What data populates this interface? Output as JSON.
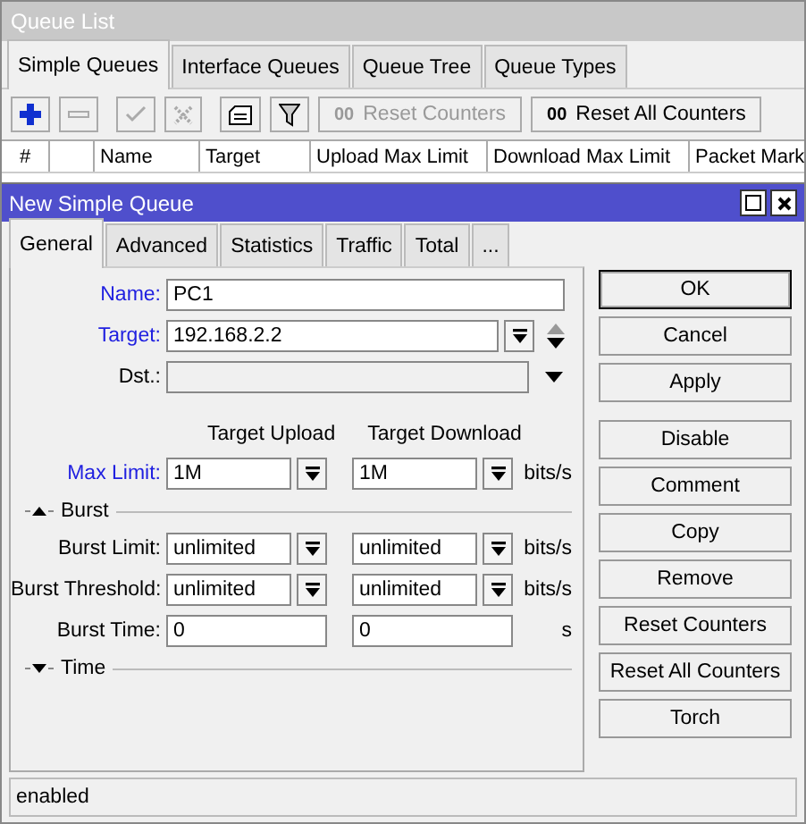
{
  "queue_list": {
    "title": "Queue List",
    "tabs": [
      {
        "label": "Simple Queues",
        "selected": true
      },
      {
        "label": "Interface Queues",
        "selected": false
      },
      {
        "label": "Queue Tree",
        "selected": false
      },
      {
        "label": "Queue Types",
        "selected": false
      }
    ],
    "toolbar": [
      {
        "kind": "add",
        "disabled": false
      },
      {
        "kind": "remove",
        "disabled": true
      },
      {
        "kind": "enable",
        "disabled": true
      },
      {
        "kind": "disable",
        "disabled": true
      },
      {
        "kind": "comment",
        "disabled": false
      },
      {
        "kind": "filter",
        "disabled": false
      },
      {
        "kind": "text",
        "mark": "00",
        "label": "Reset Counters",
        "disabled": true
      },
      {
        "kind": "text",
        "mark": "00",
        "label": "Reset All Counters",
        "disabled": false
      }
    ],
    "columns": [
      "#",
      "",
      "Name",
      "Target",
      "Upload Max Limit",
      "Download Max Limit",
      "Packet Mark"
    ]
  },
  "dialog": {
    "title": "New Simple Queue",
    "tabs": [
      {
        "label": "General",
        "selected": true
      },
      {
        "label": "Advanced",
        "selected": false
      },
      {
        "label": "Statistics",
        "selected": false
      },
      {
        "label": "Traffic",
        "selected": false
      },
      {
        "label": "Total",
        "selected": false
      },
      {
        "label": "...",
        "selected": false
      }
    ],
    "fields": [
      {
        "label": "Name:",
        "value": "PC1",
        "required": true,
        "kind": "text",
        "disabled": false
      },
      {
        "label": "Target:",
        "value": "192.168.2.2",
        "required": true,
        "kind": "list",
        "disabled": false
      },
      {
        "label": "Dst.:",
        "required": false,
        "kind": "select",
        "disabled": true
      }
    ],
    "limit_headers": [
      "Target Upload",
      "Target Download"
    ],
    "limits": [
      {
        "label": "Max Limit:",
        "required": true,
        "kind": "dropdown",
        "values": [
          "1M",
          "1M"
        ],
        "unit": "bits/s"
      }
    ],
    "sections": [
      {
        "label": "Burst",
        "expanded": true,
        "rows": [
          {
            "label": "Burst Limit:",
            "required": false,
            "kind": "dropdown",
            "values": [
              "unlimited",
              "unlimited"
            ],
            "unit": "bits/s"
          },
          {
            "label": "Burst Threshold:",
            "required": false,
            "kind": "dropdown",
            "values": [
              "unlimited",
              "unlimited"
            ],
            "unit": "bits/s"
          },
          {
            "label": "Burst Time:",
            "required": false,
            "kind": "text",
            "values": [
              "0",
              "0"
            ],
            "unit": "s"
          }
        ]
      },
      {
        "label": "Time",
        "expanded": false
      }
    ],
    "buttons": [
      {
        "label": "OK",
        "default": true,
        "separated": false
      },
      {
        "label": "Cancel",
        "default": false,
        "separated": false
      },
      {
        "label": "Apply",
        "default": false,
        "separated": false
      },
      {
        "label": "Disable",
        "default": false,
        "separated": true
      },
      {
        "label": "Comment",
        "default": false,
        "separated": false
      },
      {
        "label": "Copy",
        "default": false,
        "separated": false
      },
      {
        "label": "Remove",
        "default": false,
        "separated": false
      },
      {
        "label": "Reset Counters",
        "default": false,
        "separated": false
      },
      {
        "label": "Reset All Counters",
        "default": false,
        "separated": false
      },
      {
        "label": "Torch",
        "default": false,
        "separated": false
      }
    ],
    "status": "enabled"
  }
}
